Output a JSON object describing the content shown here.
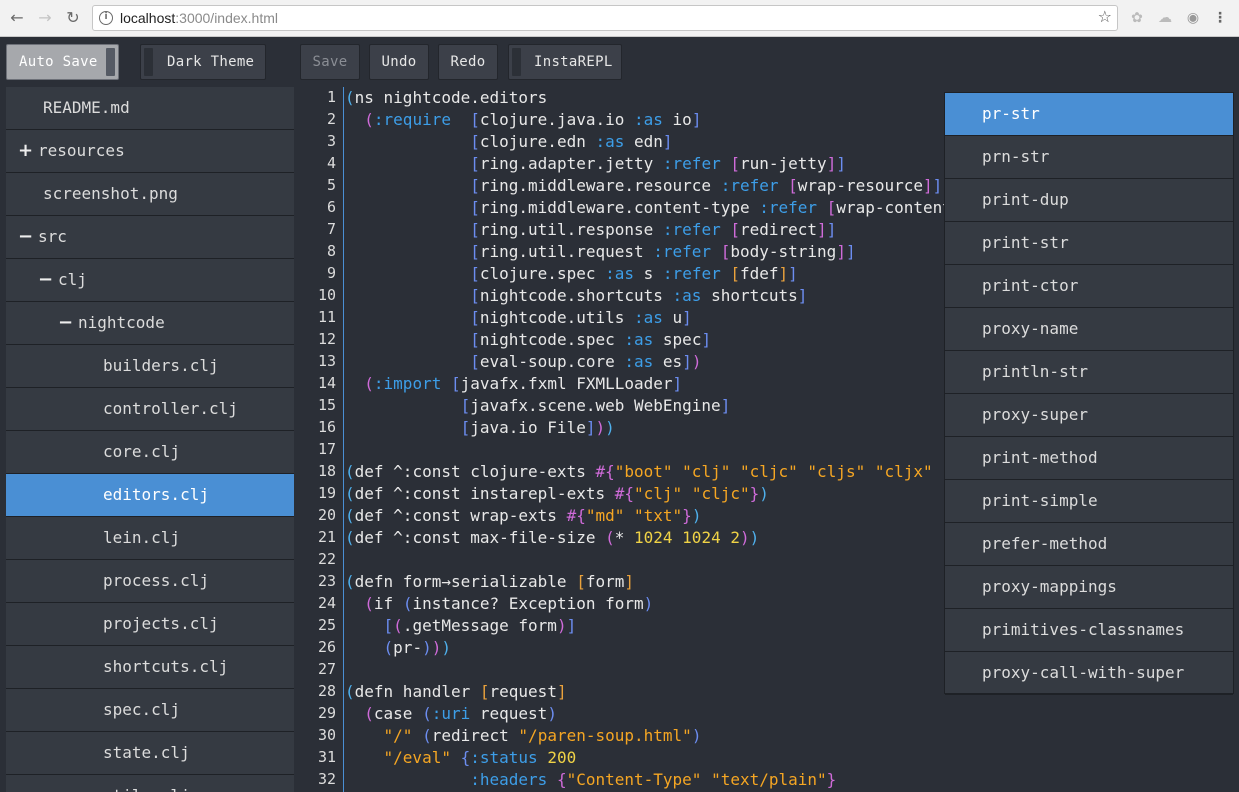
{
  "browser": {
    "url_host": "localhost",
    "url_path": ":3000/index.html"
  },
  "toolbar": {
    "auto_save": "Auto Save",
    "dark_theme": "Dark Theme",
    "save": "Save",
    "undo": "Undo",
    "redo": "Redo",
    "instarepl": "InstaREPL"
  },
  "sidebar": {
    "items": [
      {
        "label": "README.md",
        "indent": 0,
        "marker": ""
      },
      {
        "label": "resources",
        "indent": 0,
        "marker": "+"
      },
      {
        "label": "screenshot.png",
        "indent": 0,
        "marker": ""
      },
      {
        "label": "src",
        "indent": 0,
        "marker": "−"
      },
      {
        "label": "clj",
        "indent": 1,
        "marker": "−"
      },
      {
        "label": "nightcode",
        "indent": 2,
        "marker": "−"
      },
      {
        "label": "builders.clj",
        "indent": 3,
        "marker": ""
      },
      {
        "label": "controller.clj",
        "indent": 3,
        "marker": ""
      },
      {
        "label": "core.clj",
        "indent": 3,
        "marker": ""
      },
      {
        "label": "editors.clj",
        "indent": 3,
        "marker": "",
        "selected": true
      },
      {
        "label": "lein.clj",
        "indent": 3,
        "marker": ""
      },
      {
        "label": "process.clj",
        "indent": 3,
        "marker": ""
      },
      {
        "label": "projects.clj",
        "indent": 3,
        "marker": ""
      },
      {
        "label": "shortcuts.clj",
        "indent": 3,
        "marker": ""
      },
      {
        "label": "spec.clj",
        "indent": 3,
        "marker": ""
      },
      {
        "label": "state.clj",
        "indent": 3,
        "marker": ""
      },
      {
        "label": "utils.clj",
        "indent": 3,
        "marker": ""
      }
    ]
  },
  "editor": {
    "lines": [
      [
        [
          "p-a",
          "("
        ],
        [
          "",
          "ns nightcode.editors"
        ]
      ],
      [
        [
          "",
          "  "
        ],
        [
          "p-b",
          "("
        ],
        [
          "c-kw",
          ":require"
        ],
        [
          "",
          "  "
        ],
        [
          "p-c",
          "["
        ],
        [
          "",
          "clojure.java.io "
        ],
        [
          "c-kw",
          ":as"
        ],
        [
          "",
          " io"
        ],
        [
          "p-c",
          "]"
        ]
      ],
      [
        [
          "",
          "             "
        ],
        [
          "p-c",
          "["
        ],
        [
          "",
          "clojure.edn "
        ],
        [
          "c-kw",
          ":as"
        ],
        [
          "",
          " edn"
        ],
        [
          "p-c",
          "]"
        ]
      ],
      [
        [
          "",
          "             "
        ],
        [
          "p-c",
          "["
        ],
        [
          "",
          "ring.adapter.jetty "
        ],
        [
          "c-kw",
          ":refer"
        ],
        [
          "",
          " "
        ],
        [
          "p-b",
          "["
        ],
        [
          "",
          "run-jetty"
        ],
        [
          "p-b",
          "]"
        ],
        [
          "p-c",
          "]"
        ]
      ],
      [
        [
          "",
          "             "
        ],
        [
          "p-c",
          "["
        ],
        [
          "",
          "ring.middleware.resource "
        ],
        [
          "c-kw",
          ":refer"
        ],
        [
          "",
          " "
        ],
        [
          "p-b",
          "["
        ],
        [
          "",
          "wrap-resource"
        ],
        [
          "p-b",
          "]"
        ],
        [
          "p-c",
          "]"
        ]
      ],
      [
        [
          "",
          "             "
        ],
        [
          "p-c",
          "["
        ],
        [
          "",
          "ring.middleware.content-type "
        ],
        [
          "c-kw",
          ":refer"
        ],
        [
          "",
          " "
        ],
        [
          "p-b",
          "["
        ],
        [
          "",
          "wrap-content-type"
        ],
        [
          "p-b",
          "]"
        ],
        [
          "p-c",
          "]"
        ]
      ],
      [
        [
          "",
          "             "
        ],
        [
          "p-c",
          "["
        ],
        [
          "",
          "ring.util.response "
        ],
        [
          "c-kw",
          ":refer"
        ],
        [
          "",
          " "
        ],
        [
          "p-b",
          "["
        ],
        [
          "",
          "redirect"
        ],
        [
          "p-b",
          "]"
        ],
        [
          "p-c",
          "]"
        ]
      ],
      [
        [
          "",
          "             "
        ],
        [
          "p-c",
          "["
        ],
        [
          "",
          "ring.util.request "
        ],
        [
          "c-kw",
          ":refer"
        ],
        [
          "",
          " "
        ],
        [
          "p-b",
          "["
        ],
        [
          "",
          "body-string"
        ],
        [
          "p-b",
          "]"
        ],
        [
          "p-c",
          "]"
        ]
      ],
      [
        [
          "",
          "             "
        ],
        [
          "p-c",
          "["
        ],
        [
          "",
          "clojure.spec "
        ],
        [
          "c-kw",
          ":as"
        ],
        [
          "",
          " s "
        ],
        [
          "c-kw",
          ":refer"
        ],
        [
          "",
          " "
        ],
        [
          "p-d",
          "["
        ],
        [
          "",
          "fdef"
        ],
        [
          "p-d",
          "]"
        ],
        [
          "p-c",
          "]"
        ]
      ],
      [
        [
          "",
          "             "
        ],
        [
          "p-c",
          "["
        ],
        [
          "",
          "nightcode.shortcuts "
        ],
        [
          "c-kw",
          ":as"
        ],
        [
          "",
          " shortcuts"
        ],
        [
          "p-c",
          "]"
        ]
      ],
      [
        [
          "",
          "             "
        ],
        [
          "p-c",
          "["
        ],
        [
          "",
          "nightcode.utils "
        ],
        [
          "c-kw",
          ":as"
        ],
        [
          "",
          " u"
        ],
        [
          "p-c",
          "]"
        ]
      ],
      [
        [
          "",
          "             "
        ],
        [
          "p-c",
          "["
        ],
        [
          "",
          "nightcode.spec "
        ],
        [
          "c-kw",
          ":as"
        ],
        [
          "",
          " spec"
        ],
        [
          "p-c",
          "]"
        ]
      ],
      [
        [
          "",
          "             "
        ],
        [
          "p-c",
          "["
        ],
        [
          "",
          "eval-soup.core "
        ],
        [
          "c-kw",
          ":as"
        ],
        [
          "",
          " es"
        ],
        [
          "p-c",
          "]"
        ],
        [
          "p-b",
          ")"
        ]
      ],
      [
        [
          "",
          "  "
        ],
        [
          "p-b",
          "("
        ],
        [
          "c-kw",
          ":import"
        ],
        [
          "",
          " "
        ],
        [
          "p-c",
          "["
        ],
        [
          "",
          "javafx.fxml FXMLLoader"
        ],
        [
          "p-c",
          "]"
        ]
      ],
      [
        [
          "",
          "            "
        ],
        [
          "p-c",
          "["
        ],
        [
          "",
          "javafx.scene.web WebEngine"
        ],
        [
          "p-c",
          "]"
        ]
      ],
      [
        [
          "",
          "            "
        ],
        [
          "p-c",
          "["
        ],
        [
          "",
          "java.io File"
        ],
        [
          "p-c",
          "]"
        ],
        [
          "p-b",
          ")"
        ],
        [
          "p-a",
          ")"
        ]
      ],
      [
        [
          "",
          ""
        ]
      ],
      [
        [
          "p-a",
          "("
        ],
        [
          "",
          "def ^:const clojure-exts "
        ],
        [
          "p-b",
          "#{"
        ],
        [
          "c-str",
          "\"boot\""
        ],
        [
          "",
          " "
        ],
        [
          "c-str",
          "\"clj\""
        ],
        [
          "",
          " "
        ],
        [
          "c-str",
          "\"cljc\""
        ],
        [
          "",
          " "
        ],
        [
          "c-str",
          "\"cljs\""
        ],
        [
          "",
          " "
        ],
        [
          "c-str",
          "\"cljx\""
        ]
      ],
      [
        [
          "p-a",
          "("
        ],
        [
          "",
          "def ^:const instarepl-exts "
        ],
        [
          "p-b",
          "#{"
        ],
        [
          "c-str",
          "\"clj\""
        ],
        [
          "",
          " "
        ],
        [
          "c-str",
          "\"cljc\""
        ],
        [
          "p-b",
          "}"
        ],
        [
          "p-a",
          ")"
        ]
      ],
      [
        [
          "p-a",
          "("
        ],
        [
          "",
          "def ^:const wrap-exts "
        ],
        [
          "p-b",
          "#{"
        ],
        [
          "c-str",
          "\"md\""
        ],
        [
          "",
          " "
        ],
        [
          "c-str",
          "\"txt\""
        ],
        [
          "p-b",
          "}"
        ],
        [
          "p-a",
          ")"
        ]
      ],
      [
        [
          "p-a",
          "("
        ],
        [
          "",
          "def ^:const max-file-size "
        ],
        [
          "p-b",
          "("
        ],
        [
          "",
          "* "
        ],
        [
          "c-num",
          "1024"
        ],
        [
          "",
          " "
        ],
        [
          "c-num",
          "1024"
        ],
        [
          "",
          " "
        ],
        [
          "c-num",
          "2"
        ],
        [
          "p-b",
          ")"
        ],
        [
          "p-a",
          ")"
        ]
      ],
      [
        [
          "",
          ""
        ]
      ],
      [
        [
          "p-a",
          "("
        ],
        [
          "",
          "defn form→serializable "
        ],
        [
          "p-d",
          "["
        ],
        [
          "",
          "form"
        ],
        [
          "p-d",
          "]"
        ]
      ],
      [
        [
          "",
          "  "
        ],
        [
          "p-b",
          "("
        ],
        [
          "",
          "if "
        ],
        [
          "p-c",
          "("
        ],
        [
          "",
          "instance? Exception form"
        ],
        [
          "p-c",
          ")"
        ]
      ],
      [
        [
          "",
          "    "
        ],
        [
          "p-c",
          "["
        ],
        [
          "p-b",
          "("
        ],
        [
          "",
          ".getMessage form"
        ],
        [
          "p-b",
          ")"
        ],
        [
          "p-c",
          "]"
        ]
      ],
      [
        [
          "",
          "    "
        ],
        [
          "p-c",
          "("
        ],
        [
          "",
          "pr-"
        ],
        [
          "p-c",
          ")"
        ],
        [
          "p-b",
          ")"
        ],
        [
          "p-a",
          ")"
        ]
      ],
      [
        [
          "",
          ""
        ]
      ],
      [
        [
          "p-a",
          "("
        ],
        [
          "",
          "defn handler "
        ],
        [
          "p-d",
          "["
        ],
        [
          "",
          "request"
        ],
        [
          "p-d",
          "]"
        ]
      ],
      [
        [
          "",
          "  "
        ],
        [
          "p-b",
          "("
        ],
        [
          "",
          "case "
        ],
        [
          "p-c",
          "("
        ],
        [
          "c-kw",
          ":uri"
        ],
        [
          "",
          " request"
        ],
        [
          "p-c",
          ")"
        ]
      ],
      [
        [
          "",
          "    "
        ],
        [
          "c-str",
          "\"/\""
        ],
        [
          "",
          " "
        ],
        [
          "p-c",
          "("
        ],
        [
          "",
          "redirect "
        ],
        [
          "c-str",
          "\"/paren-soup.html\""
        ],
        [
          "p-c",
          ")"
        ]
      ],
      [
        [
          "",
          "    "
        ],
        [
          "c-str",
          "\"/eval\""
        ],
        [
          "",
          " "
        ],
        [
          "p-c",
          "{"
        ],
        [
          "c-kw",
          ":status"
        ],
        [
          "",
          " "
        ],
        [
          "c-num",
          "200"
        ]
      ],
      [
        [
          "",
          "             "
        ],
        [
          "c-kw",
          ":headers"
        ],
        [
          "",
          " "
        ],
        [
          "p-b",
          "{"
        ],
        [
          "c-str",
          "\"Content-Type\""
        ],
        [
          "",
          " "
        ],
        [
          "c-str",
          "\"text/plain\""
        ],
        [
          "p-b",
          "}"
        ]
      ],
      [
        [
          "",
          ""
        ]
      ]
    ]
  },
  "autocomplete": {
    "items": [
      {
        "label": "pr-str",
        "selected": true
      },
      {
        "label": "prn-str"
      },
      {
        "label": "print-dup"
      },
      {
        "label": "print-str"
      },
      {
        "label": "print-ctor"
      },
      {
        "label": "proxy-name"
      },
      {
        "label": "println-str"
      },
      {
        "label": "proxy-super"
      },
      {
        "label": "print-method"
      },
      {
        "label": "print-simple"
      },
      {
        "label": "prefer-method"
      },
      {
        "label": "proxy-mappings"
      },
      {
        "label": "primitives-classnames"
      },
      {
        "label": "proxy-call-with-super"
      }
    ]
  }
}
